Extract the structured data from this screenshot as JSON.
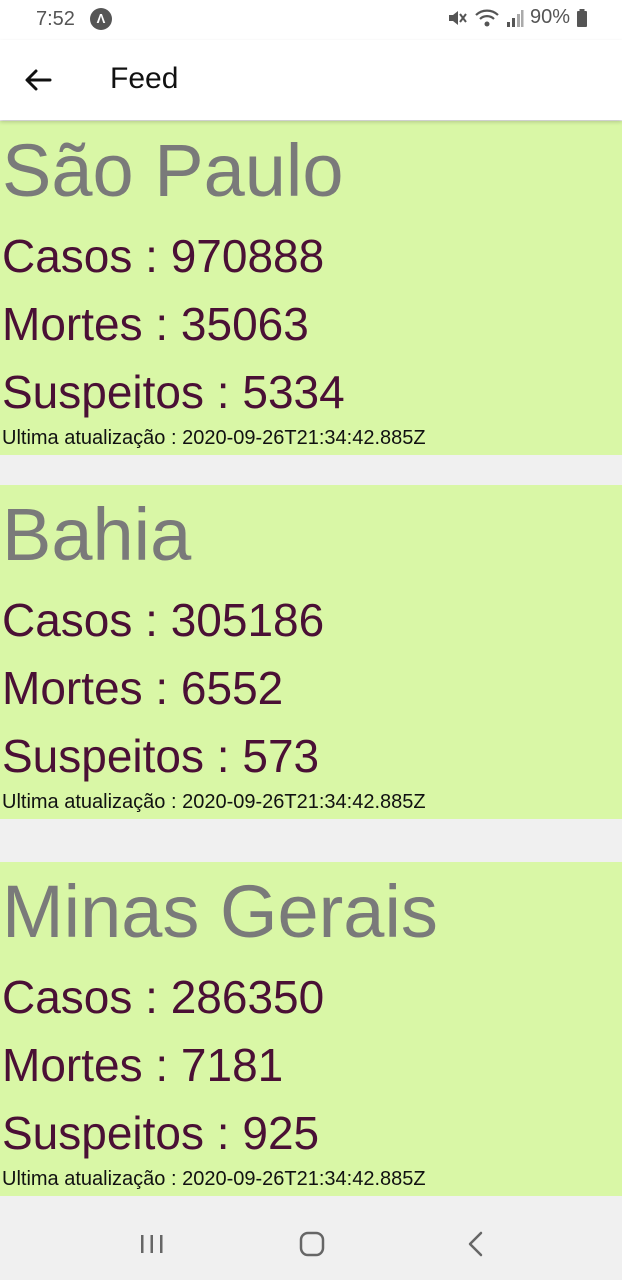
{
  "status_bar": {
    "time": "7:52",
    "app_indicator": "Λ",
    "battery": "90%",
    "icons": [
      "mute-icon",
      "wifi-icon",
      "signal-icon",
      "battery-icon"
    ]
  },
  "app_bar": {
    "title": "Feed",
    "back_icon": "arrow-left-icon"
  },
  "colors": {
    "card_background": "#d9f7a6",
    "state_text": "#7a7a7a",
    "stat_text": "#4a1035",
    "page_background": "#f0f0f0"
  },
  "cards": [
    {
      "state": "São Paulo",
      "cases": "Casos : 970888",
      "deaths": "Mortes : 35063",
      "suspects": "Suspeitos : 5334",
      "updated": "Ultima atualização : 2020-09-26T21:34:42.885Z"
    },
    {
      "state": "Bahia",
      "cases": "Casos : 305186",
      "deaths": "Mortes : 6552",
      "suspects": "Suspeitos : 573",
      "updated": "Ultima atualização : 2020-09-26T21:34:42.885Z"
    },
    {
      "state": "Minas Gerais",
      "cases": "Casos : 286350",
      "deaths": "Mortes : 7181",
      "suspects": "Suspeitos : 925",
      "updated": "Ultima atualização : 2020-09-26T21:34:42.885Z"
    }
  ],
  "nav_bar": {
    "icons": [
      "recents-icon",
      "home-icon",
      "back-icon"
    ]
  }
}
